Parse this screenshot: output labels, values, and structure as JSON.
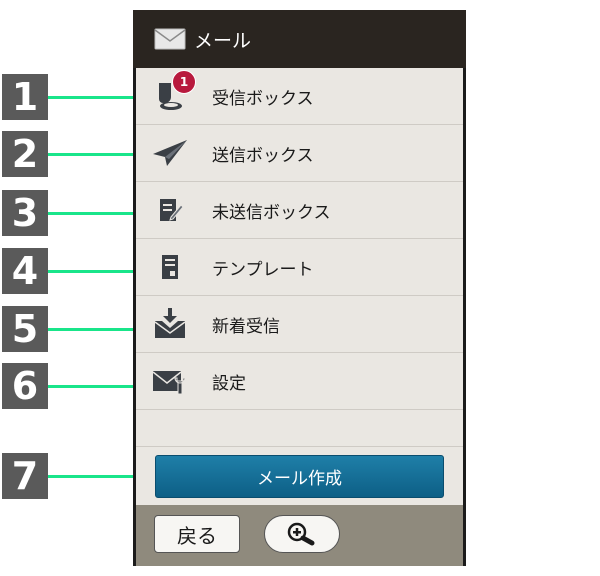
{
  "callouts": [
    "1",
    "2",
    "3",
    "4",
    "5",
    "6",
    "7"
  ],
  "header": {
    "title": "メール",
    "icon": "envelope-icon"
  },
  "menu": [
    {
      "label": "受信ボックス",
      "icon": "inbox-icon",
      "badge": "1"
    },
    {
      "label": "送信ボックス",
      "icon": "paper-plane-icon"
    },
    {
      "label": "未送信ボックス",
      "icon": "draft-note-icon"
    },
    {
      "label": "テンプレート",
      "icon": "template-document-icon"
    },
    {
      "label": "新着受信",
      "icon": "new-mail-download-icon"
    },
    {
      "label": "設定",
      "icon": "mail-settings-icon"
    }
  ],
  "compose_button": "メール作成",
  "bottom": {
    "back_label": "戻る",
    "zoom_icon": "zoom-in-icon"
  },
  "colors": {
    "leader": "#19e58a",
    "compose": "#1670a0",
    "badge": "#b8193d"
  }
}
